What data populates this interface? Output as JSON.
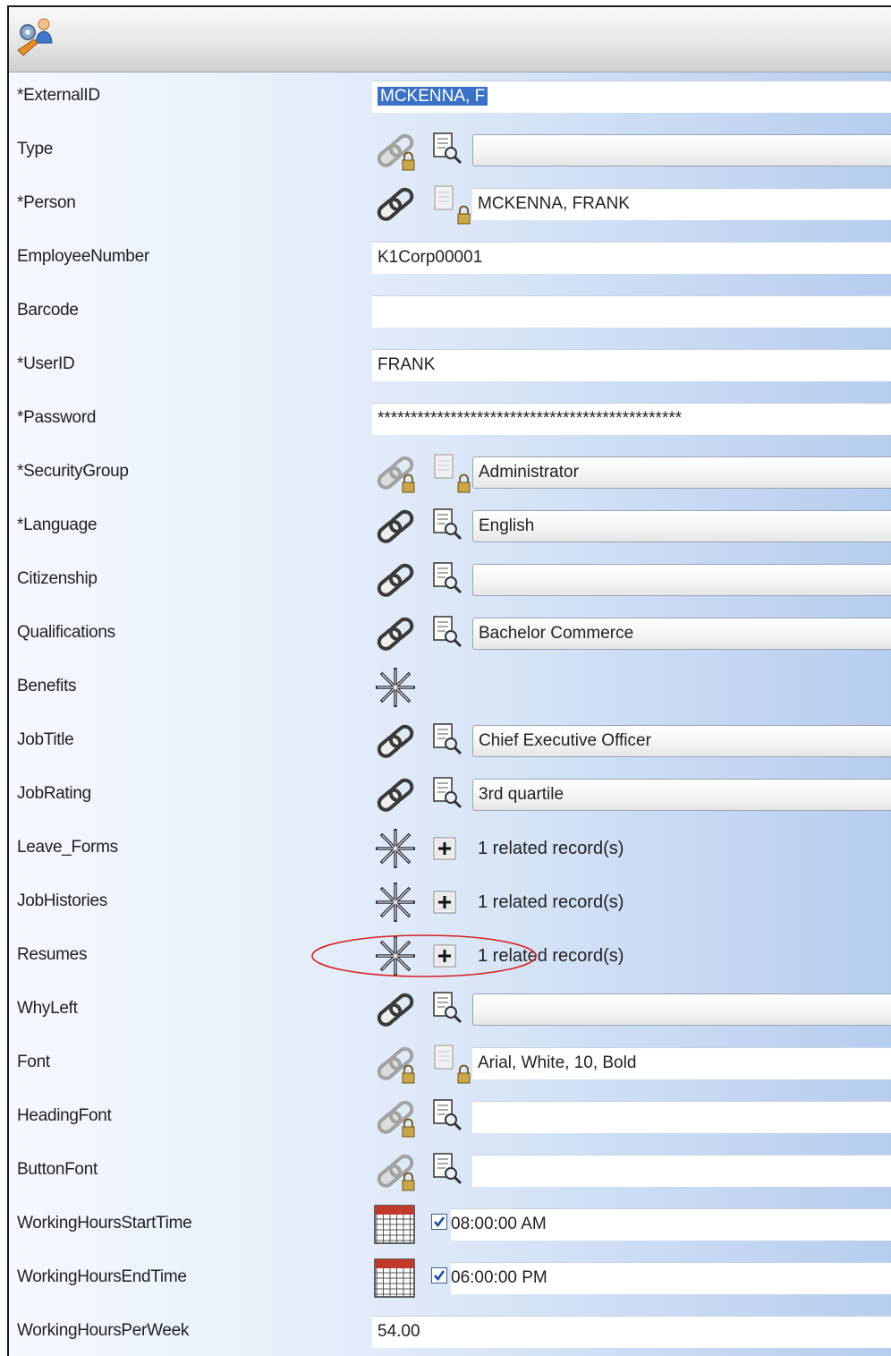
{
  "form": {
    "rows": [
      {
        "label": "*ExternalID",
        "kind": "text-selected",
        "value": "MCKENNA, F"
      },
      {
        "label": "Type",
        "kind": "combo",
        "value": "",
        "link_icon": "locked",
        "lookup_icon": "active"
      },
      {
        "label": "*Person",
        "kind": "plain",
        "value": "MCKENNA, FRANK",
        "link_icon": "active",
        "lookup_icon": "locked"
      },
      {
        "label": "EmployeeNumber",
        "kind": "text",
        "value": "K1Corp00001"
      },
      {
        "label": "Barcode",
        "kind": "text",
        "value": ""
      },
      {
        "label": "*UserID",
        "kind": "text",
        "value": "FRANK"
      },
      {
        "label": "*Password",
        "kind": "text",
        "value": "**********************************************"
      },
      {
        "label": "*SecurityGroup",
        "kind": "combo",
        "value": "Administrator",
        "link_icon": "locked",
        "lookup_icon": "locked"
      },
      {
        "label": "*Language",
        "kind": "combo",
        "value": "English",
        "link_icon": "active",
        "lookup_icon": "active"
      },
      {
        "label": "Citizenship",
        "kind": "combo",
        "value": "",
        "link_icon": "active",
        "lookup_icon": "active"
      },
      {
        "label": "Qualifications",
        "kind": "combo",
        "value": "Bachelor Commerce",
        "link_icon": "active",
        "lookup_icon": "active"
      },
      {
        "label": "Benefits",
        "kind": "asterisk"
      },
      {
        "label": "JobTitle",
        "kind": "combo",
        "value": "Chief Executive Officer",
        "link_icon": "active",
        "lookup_icon": "active"
      },
      {
        "label": "JobRating",
        "kind": "combo",
        "value": "3rd quartile",
        "link_icon": "active",
        "lookup_icon": "active"
      },
      {
        "label": "Leave_Forms",
        "kind": "related",
        "value": "1 related record(s)"
      },
      {
        "label": "JobHistories",
        "kind": "related",
        "value": "1 related record(s)"
      },
      {
        "label": "Resumes",
        "kind": "related",
        "value": "1 related record(s)",
        "highlighted": true
      },
      {
        "label": "WhyLeft",
        "kind": "combo",
        "value": "",
        "link_icon": "active",
        "lookup_icon": "active"
      },
      {
        "label": "Font",
        "kind": "plain",
        "value": "Arial, White, 10, Bold",
        "link_icon": "locked",
        "lookup_icon": "locked"
      },
      {
        "label": "HeadingFont",
        "kind": "plain",
        "value": "",
        "link_icon": "locked",
        "lookup_icon": "active"
      },
      {
        "label": "ButtonFont",
        "kind": "plain",
        "value": "",
        "link_icon": "locked",
        "lookup_icon": "active"
      },
      {
        "label": "WorkingHoursStartTime",
        "kind": "time",
        "value": "08:00:00 AM",
        "checked": true
      },
      {
        "label": "WorkingHoursEndTime",
        "kind": "time",
        "value": "06:00:00 PM",
        "checked": true
      },
      {
        "label": "WorkingHoursPerWeek",
        "kind": "text",
        "value": "54.00"
      }
    ]
  },
  "colors": {
    "selection": "#3a71c6",
    "highlight_ellipse": "#d42020",
    "check_mark": "#1c4fa0"
  }
}
